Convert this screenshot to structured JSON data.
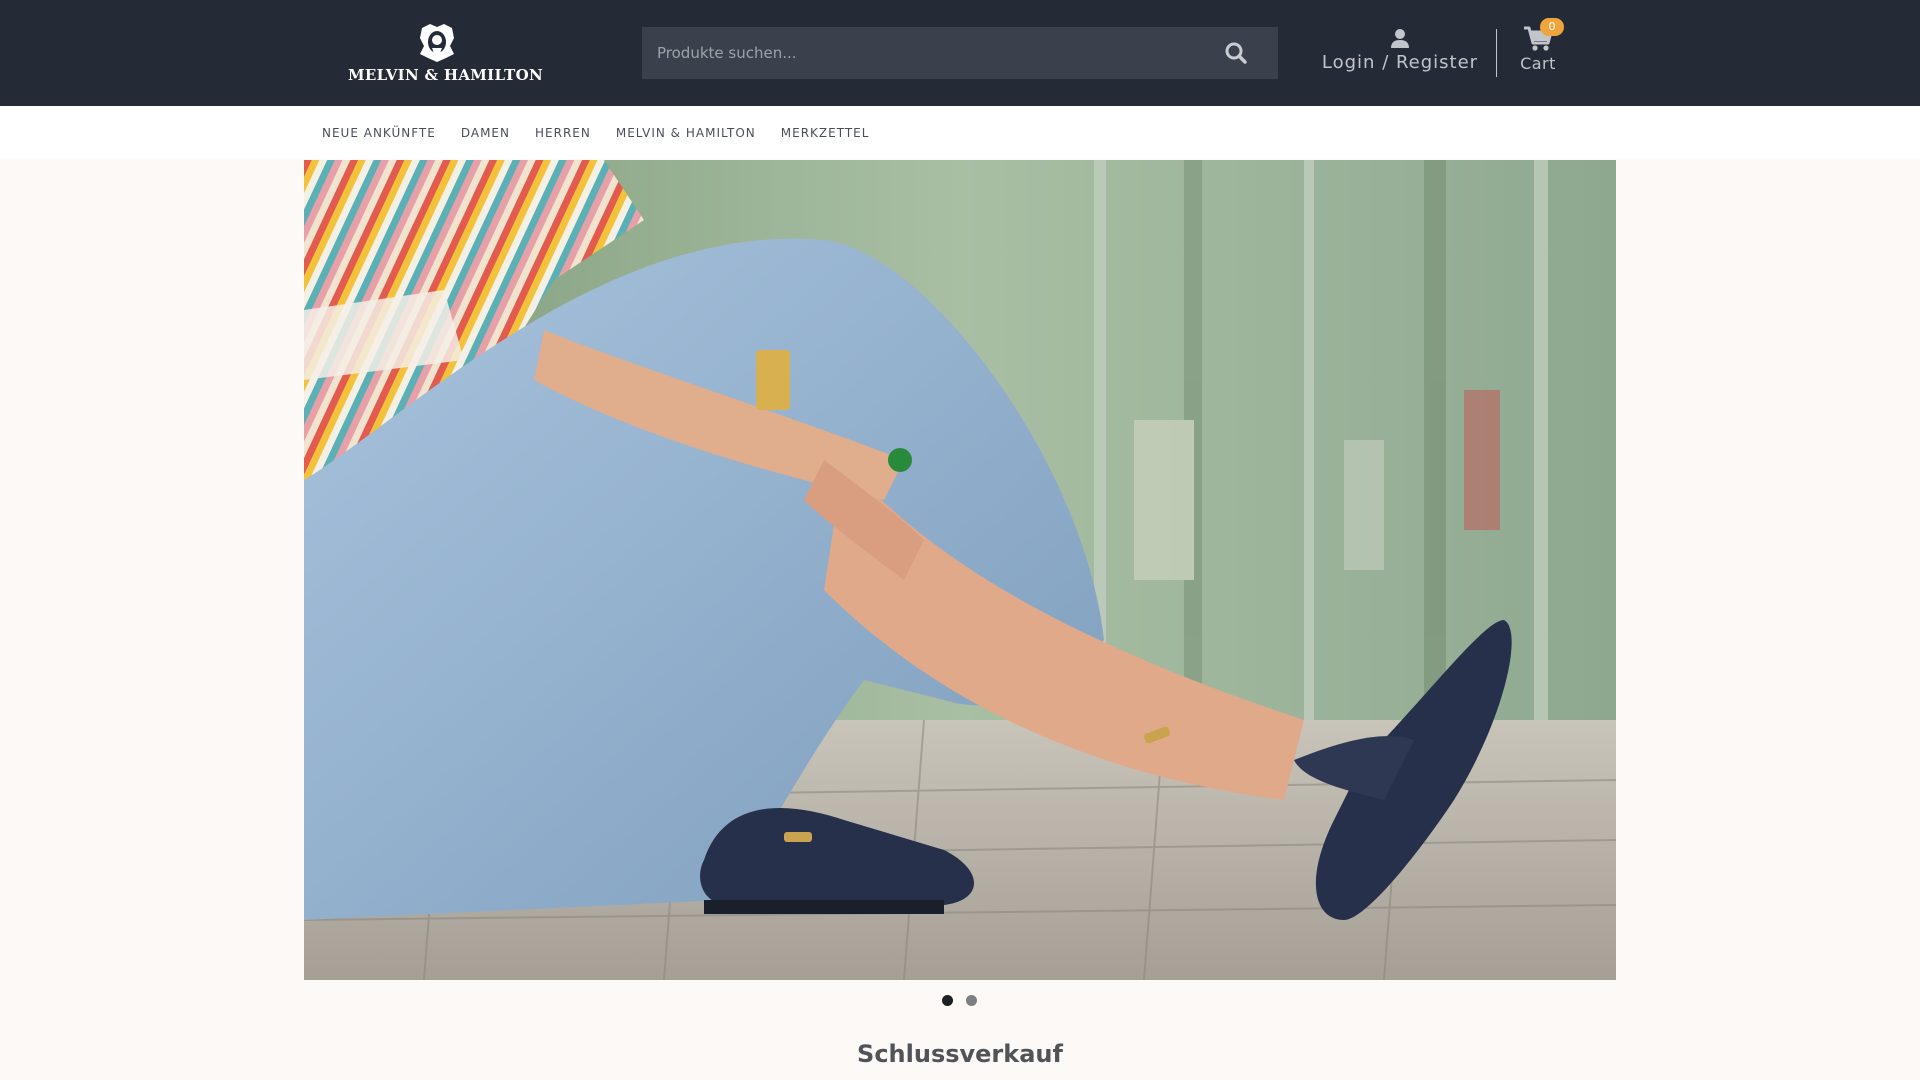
{
  "header": {
    "logo_text": "MELVIN & HAMILTON",
    "search": {
      "placeholder": "Produkte suchen..."
    },
    "login_label": "Login / Register",
    "cart": {
      "label": "Cart",
      "count": "0"
    }
  },
  "nav": {
    "items": [
      "NEUE ANKÜNFTE",
      "DAMEN",
      "HERREN",
      "MELVIN & HAMILTON",
      "MERKZETTEL"
    ]
  },
  "carousel": {
    "slide_count": 2,
    "active_slide": 1
  },
  "section": {
    "title": "Schlussverkauf"
  },
  "colors": {
    "header_bg": "#252b36",
    "search_bg": "#3b414c",
    "badge": "#f0a53c",
    "page_bg": "#fcf9f6"
  },
  "icons": [
    "crest-logo",
    "search-icon",
    "user-icon",
    "cart-icon"
  ]
}
